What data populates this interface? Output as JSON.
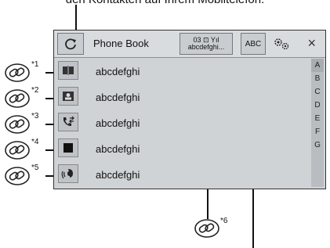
{
  "caption": "den Kontakten auf Ihrem Mobiltelefon.",
  "header": {
    "title": "Phone Book",
    "device_line1": "03 ⊡ Yıl",
    "device_line2": "abcdefghi...",
    "abc_label": "ABC",
    "close_glyph": "×"
  },
  "rows": [
    {
      "label": "abcdefghi",
      "icon": "book-icon"
    },
    {
      "label": "abcdefghi",
      "icon": "contact-card-icon"
    },
    {
      "label": "abcdefghi",
      "icon": "call-history-icon"
    },
    {
      "label": "abcdefghi",
      "icon": "square-icon"
    },
    {
      "label": "abcdefghi",
      "icon": "voice-dial-icon"
    }
  ],
  "index": [
    "A",
    "B",
    "C",
    "D",
    "E",
    "F",
    "G"
  ],
  "callouts": [
    "*1",
    "*2",
    "*3",
    "*4",
    "*5",
    "*6"
  ]
}
